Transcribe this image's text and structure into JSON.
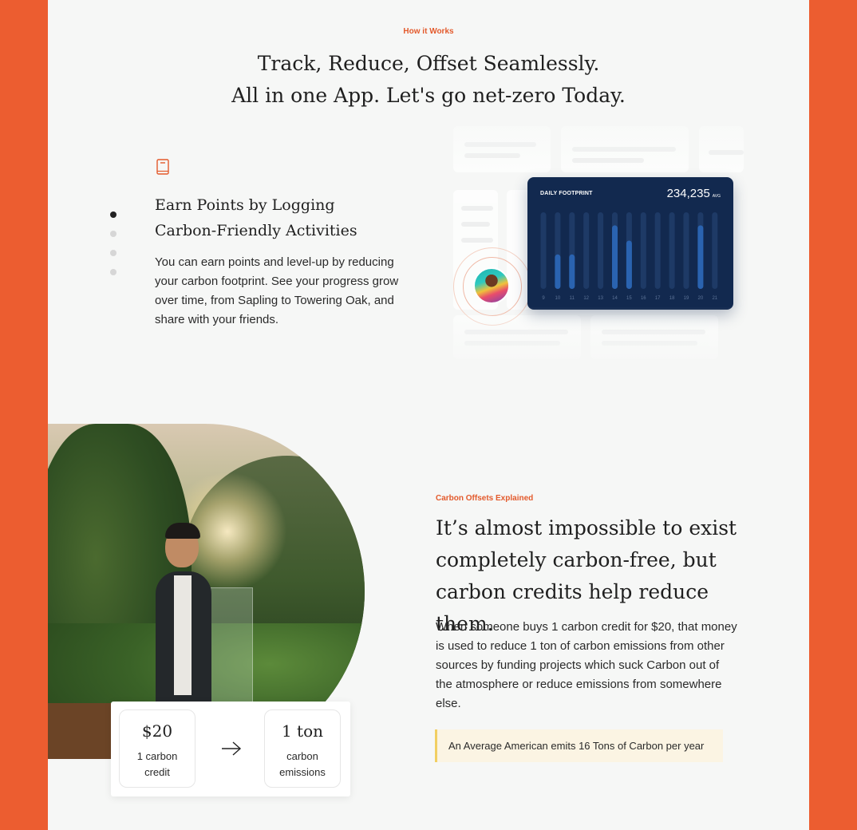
{
  "how_it_works": {
    "eyebrow": "How it Works",
    "title_line1": "Track, Reduce, Offset Seamlessly.",
    "title_line2": "All in one App. Let's go net-zero Today."
  },
  "feature": {
    "icon": "book-icon",
    "title_line1": "Earn Points by Logging",
    "title_line2": "Carbon-Friendly Activities",
    "body": "You can earn points and level-up by reducing your carbon footprint. See your progress grow over time, from Sapling to Towering Oak, and share with your friends.",
    "pagination_count": 4,
    "active_index": 0
  },
  "dashboard": {
    "label": "DAILY FOOTPRINT",
    "value": "234,235",
    "value_unit": "AVG",
    "days": [
      "9",
      "10",
      "11",
      "12",
      "13",
      "14",
      "15",
      "16",
      "17",
      "18",
      "19",
      "20",
      "21"
    ],
    "levels": [
      0,
      0.45,
      0.45,
      0,
      0,
      0.83,
      0.63,
      0,
      0,
      0,
      0,
      0.83,
      0
    ],
    "bar_color": "#2a63b0",
    "track_color": "#1e3a66"
  },
  "carbon_offsets": {
    "eyebrow": "Carbon Offsets Explained",
    "title_line1": "It’s almost impossible to exist",
    "title_line2": "completely carbon-free, but",
    "title_line3": "carbon credits help reduce them.",
    "body": "When someone buys 1 carbon credit for $20, that money is used to reduce 1 ton of carbon emissions from other sources by funding projects which suck Carbon out of the atmosphere or reduce emissions from somewhere else.",
    "callout": "An Average American emits 16 Tons of Carbon per year"
  },
  "conversion": {
    "left_value": "$20",
    "left_label": "1 carbon credit",
    "arrow_icon": "arrow-right-icon",
    "right_value": "1 ton",
    "right_label": "carbon emissions"
  },
  "colors": {
    "brand": "#ec5d30",
    "accent_text": "#e35a2c",
    "dashboard_bg": "#12294f",
    "callout_bg": "#fbf4e3",
    "callout_border": "#f1cf62"
  }
}
